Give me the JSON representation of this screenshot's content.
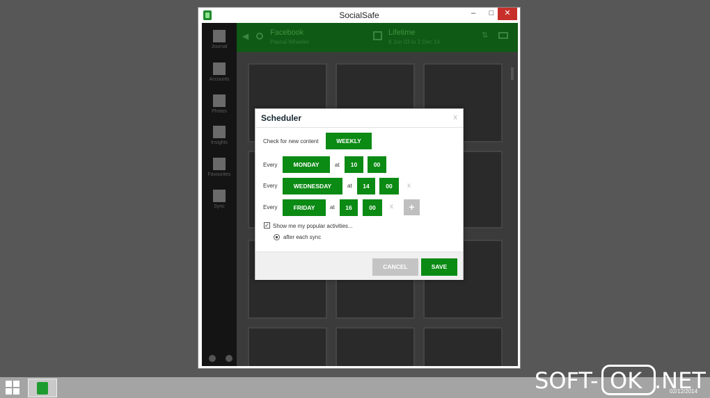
{
  "window": {
    "title": "SocialSafe",
    "minimize": "–",
    "maximize": "□",
    "close": "✕"
  },
  "sidebar": {
    "items": [
      {
        "label": "Journal",
        "icon": "journal-icon"
      },
      {
        "label": "Accounts",
        "icon": "grid-icon"
      },
      {
        "label": "Photos",
        "icon": "photo-icon"
      },
      {
        "label": "Insights",
        "icon": "chart-icon"
      },
      {
        "label": "Favourites",
        "icon": "heart-icon"
      },
      {
        "label": "Sync",
        "icon": "refresh-icon"
      }
    ]
  },
  "header": {
    "source_title": "Facebook",
    "source_sub": "Pascal Wheeler",
    "period_title": "Lifetime",
    "period_sub": "8 Jun 03 to 2 Dec 14"
  },
  "dialog": {
    "title": "Scheduler",
    "close": "x",
    "check_label": "Check for new content",
    "frequency": "WEEKLY",
    "rows": [
      {
        "every": "Every",
        "day": "MONDAY",
        "at": "at",
        "hour": "10",
        "minute": "00"
      },
      {
        "every": "Every",
        "day": "WEDNESDAY",
        "at": "at",
        "hour": "14",
        "minute": "00",
        "remove": "x"
      },
      {
        "every": "Every",
        "day": "FRIDAY",
        "at": "at",
        "hour": "16",
        "minute": "00",
        "remove": "x",
        "add": "+"
      }
    ],
    "popular_label": "Show me my popular activities...",
    "popular_checked": true,
    "after_sync_label": "after each sync",
    "cancel": "CANCEL",
    "save": "SAVE"
  },
  "taskbar": {
    "date": "02/12/2014"
  },
  "watermark": {
    "left": "SOFT-",
    "middle": "OK",
    "right": ".NET"
  }
}
